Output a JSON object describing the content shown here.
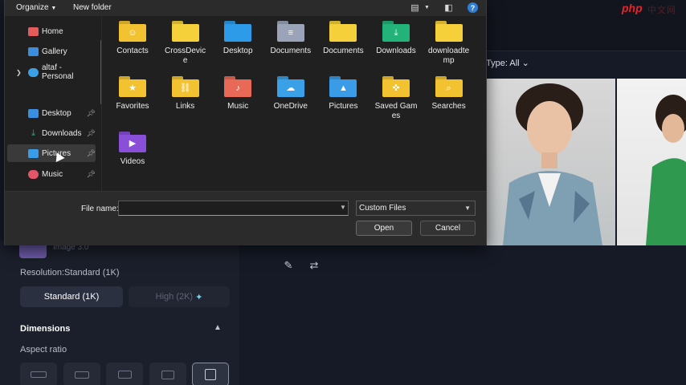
{
  "toolbar": {
    "organize": "Organize",
    "new_folder": "New folder"
  },
  "nav": {
    "items": [
      {
        "label": "Home",
        "icon": "home-icon",
        "color": "#e45b5b"
      },
      {
        "label": "Gallery",
        "icon": "gallery-icon",
        "color": "#3b8ddd"
      },
      {
        "label": "altaf - Personal",
        "icon": "onedrive-icon",
        "color": "#3aa0e8"
      },
      {
        "label": "Desktop",
        "icon": "desktop-icon",
        "color": "#3a8fe0"
      },
      {
        "label": "Downloads",
        "icon": "download-icon",
        "color": "#2fb37a"
      },
      {
        "label": "Pictures",
        "icon": "pictures-icon",
        "color": "#3a9be6"
      },
      {
        "label": "Music",
        "icon": "music-icon",
        "color": "#e2566a"
      }
    ]
  },
  "files": [
    {
      "label": "Contacts",
      "icon": "contacts-folder-icon",
      "color": "#f2c230"
    },
    {
      "label": "CrossDevice",
      "icon": "folder-icon",
      "color": "#f5d03b"
    },
    {
      "label": "Desktop",
      "icon": "desktop-folder-icon",
      "color": "#2d9be8"
    },
    {
      "label": "Documents",
      "icon": "documents-folder-icon",
      "color": "#9aa3b8"
    },
    {
      "label": "Documents",
      "icon": "folder-icon",
      "color": "#f5d03b"
    },
    {
      "label": "Downloads",
      "icon": "downloads-folder-icon",
      "color": "#22b27a"
    },
    {
      "label": "downloadtemp",
      "icon": "folder-icon",
      "color": "#f5d03b"
    },
    {
      "label": "Favorites",
      "icon": "favorites-folder-icon",
      "color": "#f2c230"
    },
    {
      "label": "Links",
      "icon": "links-folder-icon",
      "color": "#f2c230"
    },
    {
      "label": "Music",
      "icon": "music-folder-icon",
      "color": "#e86a56"
    },
    {
      "label": "OneDrive",
      "icon": "onedrive-folder-icon",
      "color": "#3aa0e8"
    },
    {
      "label": "Pictures",
      "icon": "pictures-folder-icon",
      "color": "#3a9be6"
    },
    {
      "label": "Saved Games",
      "icon": "saved-games-folder-icon",
      "color": "#f2c230"
    },
    {
      "label": "Searches",
      "icon": "searches-folder-icon",
      "color": "#f2c230"
    },
    {
      "label": "Videos",
      "icon": "videos-folder-icon",
      "color": "#8a4fd8"
    }
  ],
  "bottom": {
    "file_name_label": "File name:",
    "file_name_value": "",
    "filter_value": "Custom Files",
    "open_label": "Open",
    "cancel_label": "Cancel"
  },
  "background": {
    "type_filter": "Type: All",
    "faded_model": "Image 3.0",
    "resolution_label": "Resolution:Standard (1K)",
    "res_standard": "Standard (1K)",
    "res_high": "High (2K)",
    "dimensions_title": "Dimensions",
    "aspect_label": "Aspect ratio"
  },
  "brand": {
    "logo": "php"
  }
}
